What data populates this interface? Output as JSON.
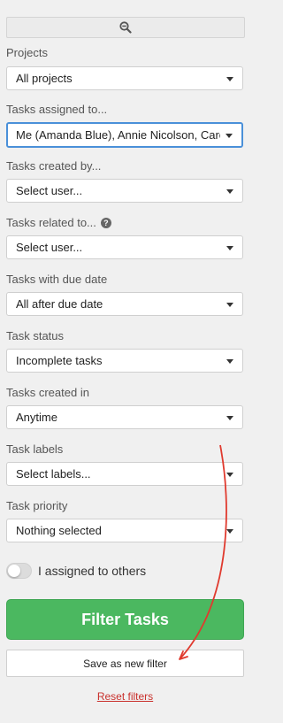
{
  "toolbar": {
    "zoom_icon": "zoom-out-icon"
  },
  "filters": [
    {
      "label": "Projects",
      "value": "All projects"
    },
    {
      "label": "Tasks assigned to...",
      "value": "Me (Amanda Blue), Annie Nicolson, Carolina"
    },
    {
      "label": "Tasks created by...",
      "value": "Select user..."
    },
    {
      "label": "Tasks related to...",
      "value": "Select user...",
      "help_icon": "question-circle-icon"
    },
    {
      "label": "Tasks with due date",
      "value": "All after due date"
    },
    {
      "label": "Task status",
      "value": "Incomplete tasks"
    },
    {
      "label": "Tasks created in",
      "value": "Anytime"
    },
    {
      "label": "Task labels",
      "value": "Select labels..."
    },
    {
      "label": "Task priority",
      "value": "Nothing selected"
    }
  ],
  "toggle": {
    "label": "I assigned to others",
    "checked": false
  },
  "actions": {
    "filter_label": "Filter Tasks",
    "save_label": "Save as new filter",
    "reset_label": "Reset filters"
  },
  "colors": {
    "filter_button": "#4bb860",
    "reset_link": "#c9302c",
    "annotation_arrow": "#e03a2e",
    "focus_border": "#4a90d9"
  }
}
